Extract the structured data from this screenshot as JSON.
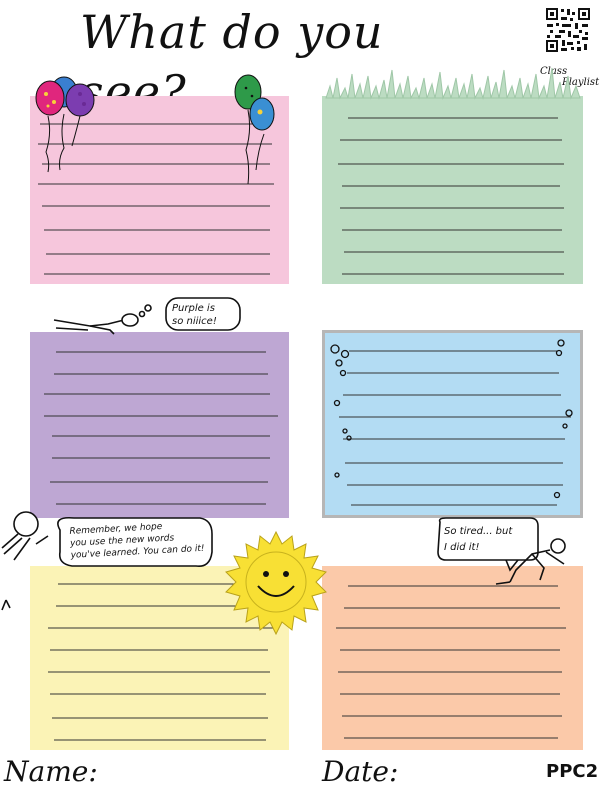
{
  "worksheet": {
    "title": "What do you see?",
    "qr_caption_line1": "Class",
    "qr_caption_line2": "Playlist",
    "speech_purple": "Purple is so niiice!",
    "speech_remember_1": "Remember, we hope",
    "speech_remember_2": "you use the new words",
    "speech_remember_3": "you've learned. You can do it!",
    "speech_tired_1": "So tired... but",
    "speech_tired_2": "I did it!",
    "name_label": "Name:",
    "date_label": "Date:",
    "page_code": "PPC2"
  },
  "colors": {
    "pink": "#f6c6dc",
    "green": "#bcdcc2",
    "purple": "#bea7d3",
    "blue": "#b3dcf3",
    "yellow": "#fbf3b6",
    "orange": "#fbc9a9",
    "sun": "#f8e034"
  },
  "icons": [
    "qr-code-icon",
    "balloons-icon",
    "grass-icon",
    "sleeping-figure-icon",
    "microphone-icon",
    "smiling-sun-icon",
    "tired-figure-icon"
  ]
}
